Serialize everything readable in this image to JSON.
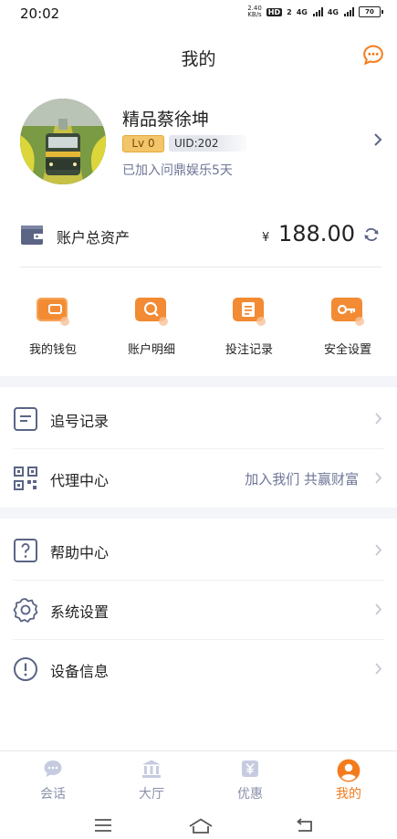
{
  "status_bar": {
    "time": "20:02",
    "net_speed_value": "2.40",
    "net_speed_unit": "KB/s",
    "hd_badge": "HD",
    "sim_badge": "2",
    "signal_1": "4G",
    "signal_2": "4G",
    "battery": "70"
  },
  "header": {
    "title": "我的",
    "chat_icon": "chat-bubble-icon"
  },
  "profile": {
    "username": "精品蔡徐坤",
    "level": "Lv 0",
    "uid": "UID:202",
    "joined_text": "已加入问鼎娱乐5天"
  },
  "assets": {
    "label": "账户总资产",
    "currency": "¥",
    "amount": "188.00"
  },
  "quick_actions": [
    {
      "label": "我的钱包",
      "icon": "wallet-icon"
    },
    {
      "label": "账户明细",
      "icon": "search-detail-icon"
    },
    {
      "label": "投注记录",
      "icon": "bet-record-icon"
    },
    {
      "label": "安全设置",
      "icon": "key-icon"
    }
  ],
  "menu": {
    "chase_record": "追号记录",
    "agent_center": "代理中心",
    "agent_promo": "加入我们 共赢财富",
    "help_center": "帮助中心",
    "system_settings": "系统设置",
    "device_info": "设备信息"
  },
  "tabs": [
    {
      "label": "会话",
      "icon": "chat-icon"
    },
    {
      "label": "大厅",
      "icon": "hall-icon"
    },
    {
      "label": "优惠",
      "icon": "promo-icon"
    },
    {
      "label": "我的",
      "icon": "user-icon"
    }
  ],
  "colors": {
    "accent": "#f47b1c",
    "icon_muted": "#5b6485",
    "secondary_text": "#6e7696",
    "tab_inactive": "#8a90aa",
    "background_band": "#f4f5f9"
  }
}
